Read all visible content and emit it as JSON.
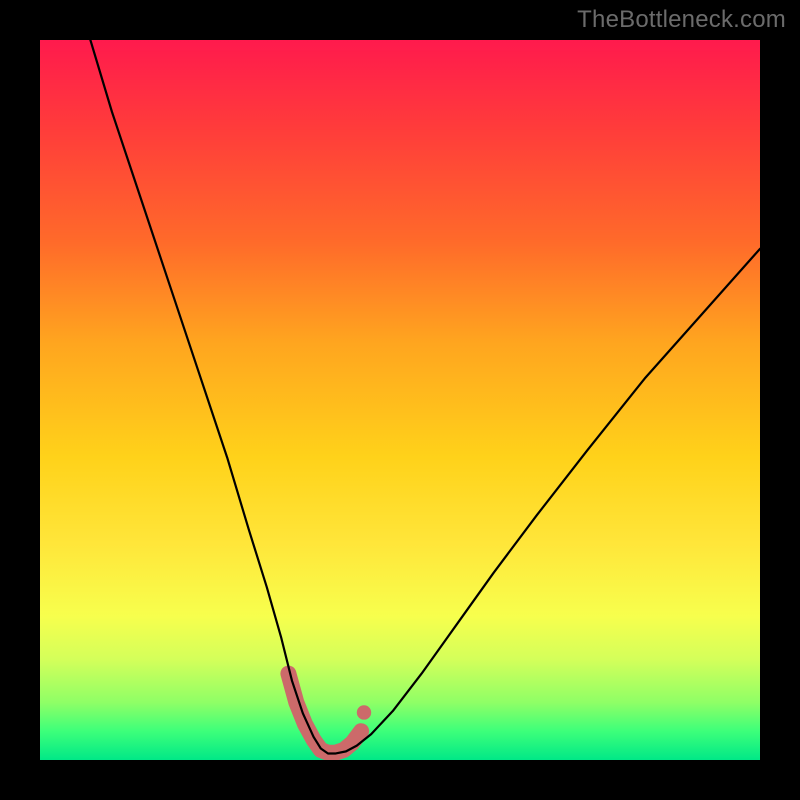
{
  "watermark": "TheBottleneck.com",
  "chart_data": {
    "type": "line",
    "title": "",
    "xlabel": "",
    "ylabel": "",
    "xlim": [
      0,
      100
    ],
    "ylim": [
      0,
      100
    ],
    "grid": false,
    "series": [
      {
        "name": "bottleneck-curve",
        "x": [
          7,
          10,
          14,
          18,
          22,
          26,
          29,
          31.5,
          33.5,
          35,
          36.5,
          38,
          39,
          40,
          41,
          42.5,
          44,
          46,
          49,
          53,
          58,
          63,
          69,
          76,
          84,
          92,
          100
        ],
        "y": [
          100,
          90,
          78,
          66,
          54,
          42,
          32,
          24,
          17,
          11,
          6.5,
          3.2,
          1.6,
          0.9,
          0.9,
          1.2,
          2.0,
          3.6,
          6.8,
          12,
          19,
          26,
          34,
          43,
          53,
          62,
          71
        ],
        "color": "#000000",
        "stroke_width": 2.2
      },
      {
        "name": "marker-band",
        "x": [
          34.5,
          35.6,
          36.8,
          38.0,
          39.0,
          40.0,
          41.0,
          42.2,
          43.4,
          44.6,
          45.0,
          45.8
        ],
        "y": [
          12.0,
          8.0,
          5.0,
          2.8,
          1.4,
          1.0,
          1.0,
          1.4,
          2.4,
          4.0,
          6.6,
          4.8
        ],
        "color": "#cc6a6a",
        "stroke_width": 16
      }
    ],
    "gradient_stops": [
      {
        "pos": 0,
        "color": "#ff1a4d"
      },
      {
        "pos": 12,
        "color": "#ff3b3b"
      },
      {
        "pos": 28,
        "color": "#ff6a2a"
      },
      {
        "pos": 42,
        "color": "#ffa51f"
      },
      {
        "pos": 58,
        "color": "#ffd21a"
      },
      {
        "pos": 70,
        "color": "#ffe63a"
      },
      {
        "pos": 80,
        "color": "#f7ff4d"
      },
      {
        "pos": 86,
        "color": "#d4ff5a"
      },
      {
        "pos": 92,
        "color": "#8fff66"
      },
      {
        "pos": 96,
        "color": "#3dff7a"
      },
      {
        "pos": 100,
        "color": "#00e887"
      }
    ]
  }
}
